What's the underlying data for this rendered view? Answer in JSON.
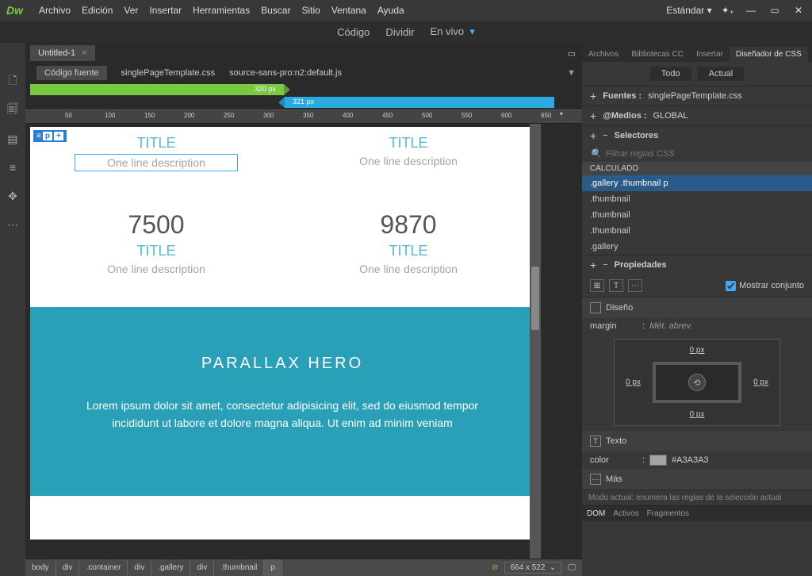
{
  "logo": "Dw",
  "menu": [
    "Archivo",
    "Edición",
    "Ver",
    "Insertar",
    "Herramientas",
    "Buscar",
    "Sitio",
    "Ventana",
    "Ayuda"
  ],
  "workspace": "Estándar",
  "view_modes": {
    "code": "Código",
    "split": "Dividir",
    "live": "En vivo"
  },
  "doc_tab": "Untitled-1",
  "related": {
    "source": "Código fuente",
    "css": "singlePageTemplate.css",
    "js": "source-sans-pro:n2:default.js"
  },
  "mq": {
    "bp1": "320  px",
    "bp2": "321  px"
  },
  "ruler_ticks": [
    "50",
    "100",
    "150",
    "200",
    "250",
    "300",
    "350",
    "400",
    "450",
    "500",
    "550",
    "600",
    "650"
  ],
  "element_badge": {
    "p": "p",
    "plus": "+"
  },
  "canvas": {
    "row1": [
      {
        "title": "TITLE",
        "desc": "One line description"
      },
      {
        "title": "TITLE",
        "desc": "One line description"
      }
    ],
    "row2": [
      {
        "num": "7500",
        "title": "TITLE",
        "desc": "One line description"
      },
      {
        "num": "9870",
        "title": "TITLE",
        "desc": "One line description"
      }
    ],
    "hero": {
      "title": "PARALLAX HERO",
      "text": "Lorem ipsum dolor sit amet, consectetur adipisicing elit, sed do eiusmod tempor incididunt ut labore et dolore magna aliqua. Ut enim ad minim veniam"
    }
  },
  "breadcrumb": [
    "body",
    "div",
    ".container",
    "div",
    ".gallery",
    "div",
    ".thumbnail",
    "p"
  ],
  "canvas_size": "664 x 522",
  "panels": {
    "tabs": [
      "Archivos",
      "Bibliotecas CC",
      "Insertar",
      "Diseñador de CSS"
    ],
    "subtabs": {
      "all": "Todo",
      "current": "Actual"
    },
    "fuentes": {
      "label": "Fuentes :",
      "value": "singlePageTemplate.css"
    },
    "medios": {
      "label": "@Medios :",
      "value": "GLOBAL"
    },
    "selectores": "Selectores",
    "filter_placeholder": "Filtrar reglas CSS",
    "calculado": "CALCULADO",
    "selectors": [
      ".gallery .thumbnail p",
      ".thumbnail",
      ".thumbnail",
      ".thumbnail",
      ".gallery"
    ],
    "propiedades": "Propiedades",
    "show_set": "Mostrar conjunto",
    "diseno": "Diseño",
    "margin_label": "margin",
    "margin_abbrev": "Mét. abrev.",
    "margin_vals": {
      "top": "0 px",
      "right": "0 px",
      "bottom": "0 px",
      "left": "0 px"
    },
    "texto": "Texto",
    "color_label": "color",
    "color_value": "#A3A3A3",
    "mas": "Más",
    "mode_note": "Modo actual: enumera las reglas de la selección actual"
  },
  "bottom_tabs": [
    "DOM",
    "Activos",
    "Fragmentos"
  ]
}
